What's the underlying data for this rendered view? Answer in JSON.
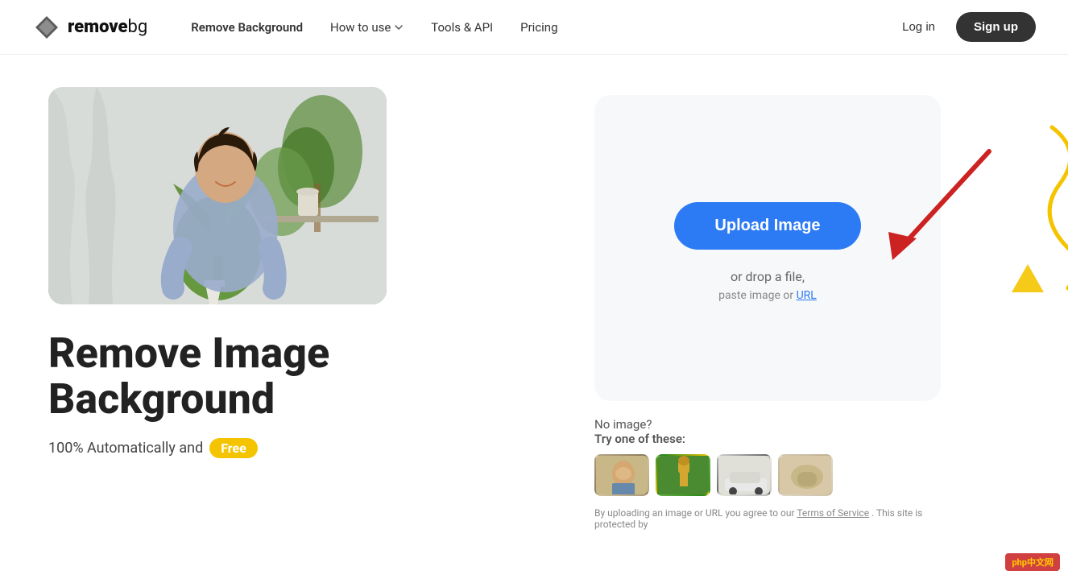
{
  "brand": {
    "logo_text_bold": "remove",
    "logo_text_light": "bg",
    "tagline": "Remove Background"
  },
  "nav": {
    "remove_bg_label": "Remove Background",
    "how_to_use_label": "How to use",
    "tools_api_label": "Tools & API",
    "pricing_label": "Pricing",
    "login_label": "Log in",
    "signup_label": "Sign up"
  },
  "hero": {
    "headline_line1": "Remove Image",
    "headline_line2": "Background",
    "subline": "100% Automatically and",
    "free_badge": "Free"
  },
  "upload": {
    "btn_label": "Upload Image",
    "drop_label": "or drop a file,",
    "paste_label": "paste image or",
    "url_label": "URL"
  },
  "samples": {
    "no_image_label": "No image?",
    "try_label": "Try one of these:"
  },
  "footer_text": {
    "part1": "By uploading an image or URL you agree to our",
    "terms_label": "Terms of Service",
    "part2": ". This site is protected by"
  },
  "php_badge": {
    "prefix": "php",
    "suffix": "中文网"
  }
}
